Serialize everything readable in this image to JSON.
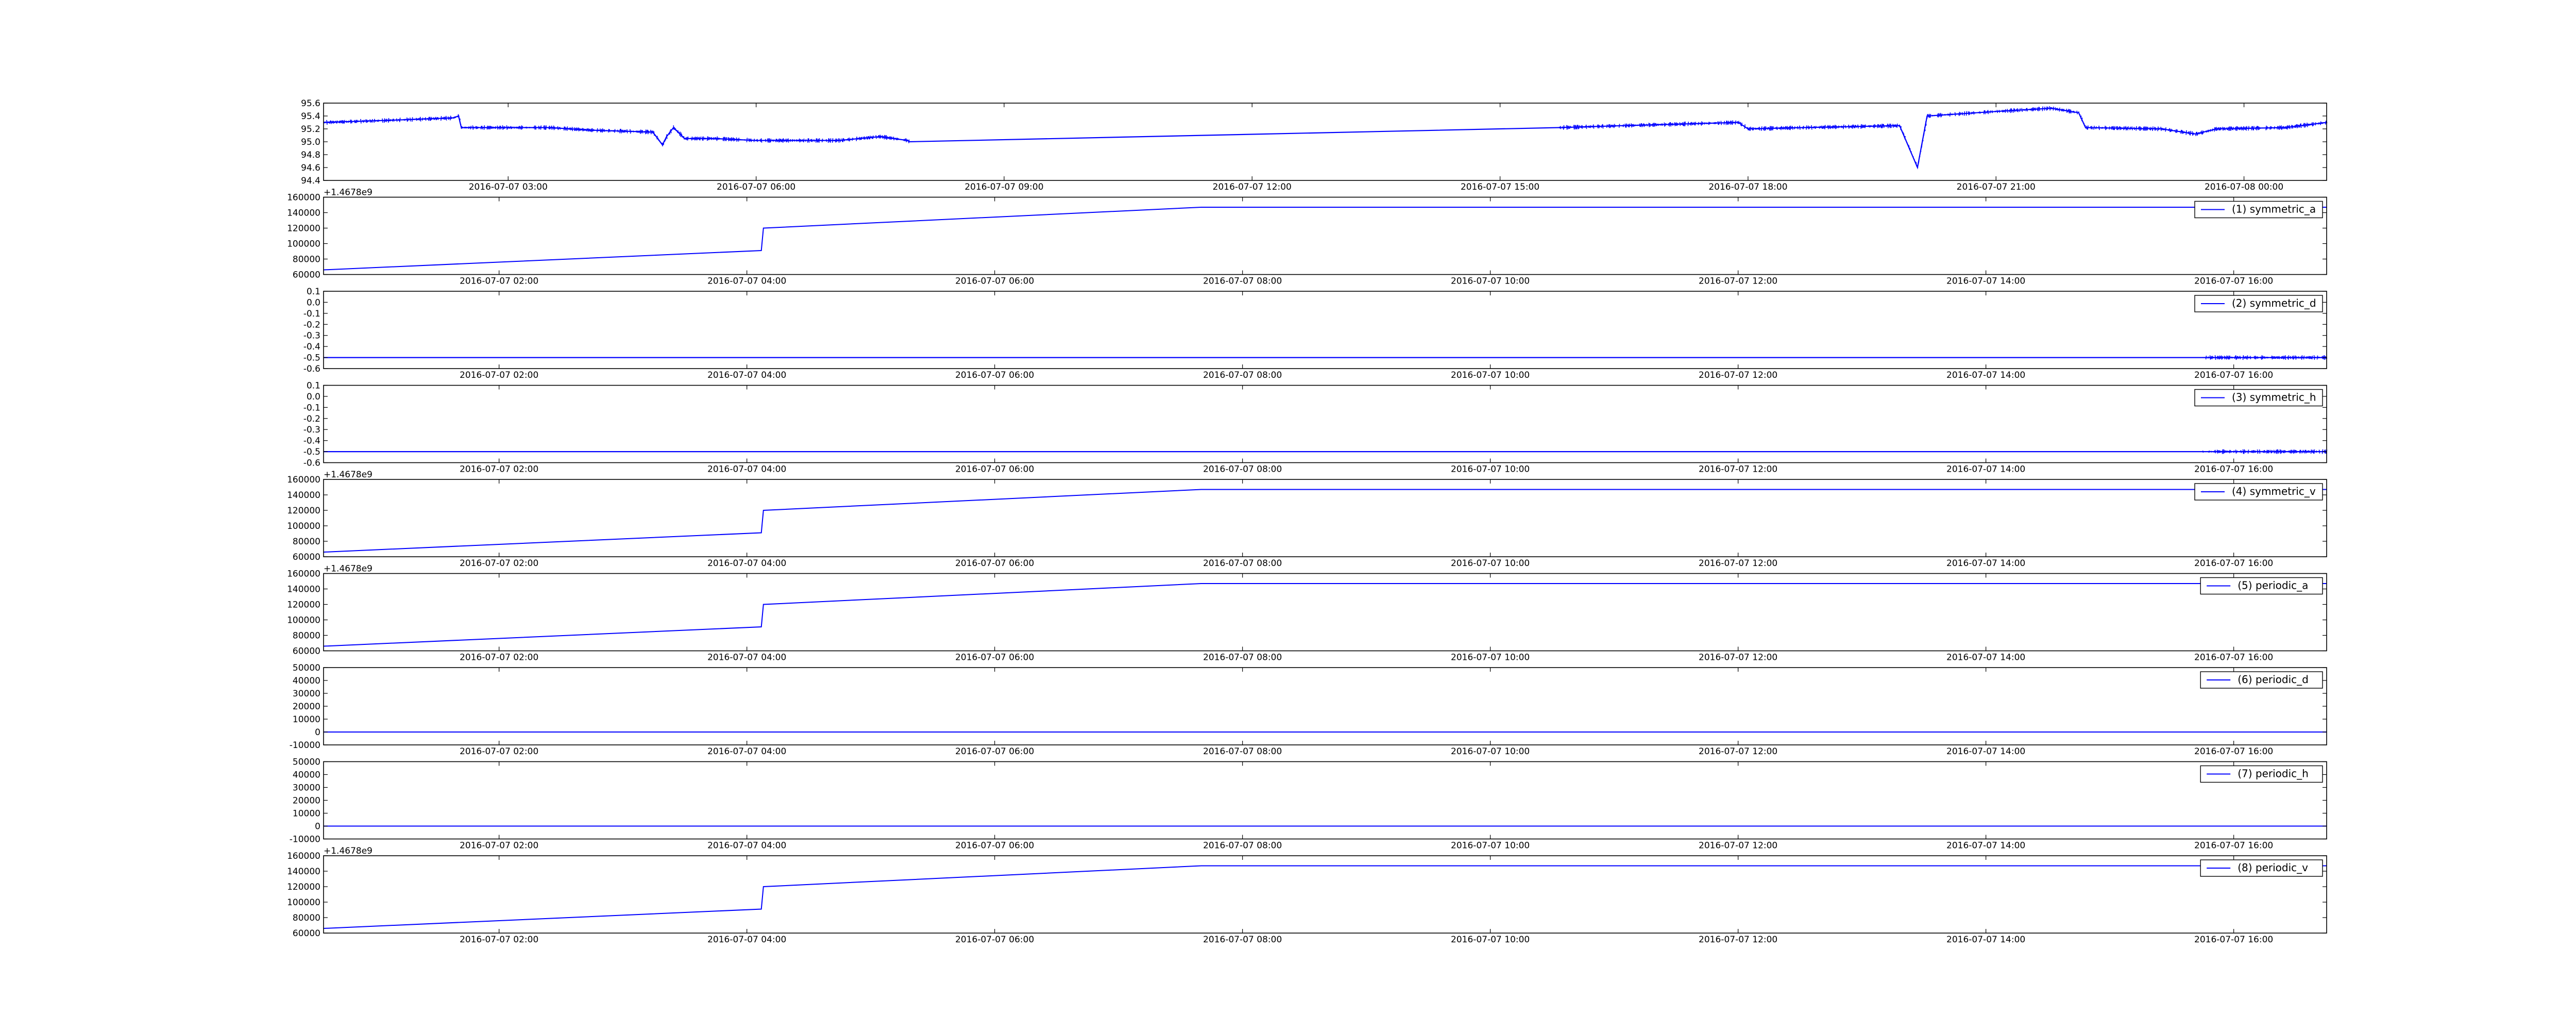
{
  "figure": {
    "background": "#ffffff"
  },
  "chart_data": [
    {
      "type": "line",
      "color": "#0000ff",
      "noisy": true,
      "ylim": [
        94.4,
        95.6
      ],
      "yticks": [
        "94.4",
        "94.6",
        "94.8",
        "95.0",
        "95.2",
        "95.4",
        "95.6"
      ],
      "offset_label": "",
      "x_range": [
        "2016-07-07 00:46",
        "2016-07-08 01:00"
      ],
      "xticks": [
        "2016-07-07 03:00",
        "2016-07-07 06:00",
        "2016-07-07 09:00",
        "2016-07-07 12:00",
        "2016-07-07 15:00",
        "2016-07-07 18:00",
        "2016-07-07 21:00",
        "2016-07-08 00:00"
      ],
      "legend": "",
      "points": [
        [
          "2016-07-07 00:46",
          95.3
        ],
        [
          "2016-07-07 01:30",
          95.33
        ],
        [
          "2016-07-07 02:20",
          95.37
        ],
        [
          "2016-07-07 02:24",
          95.4
        ],
        [
          "2016-07-07 02:26",
          95.22
        ],
        [
          "2016-07-07 03:30",
          95.22
        ],
        [
          "2016-07-07 04:00",
          95.18
        ],
        [
          "2016-07-07 04:45",
          95.15
        ],
        [
          "2016-07-07 04:52",
          94.95
        ],
        [
          "2016-07-07 04:55",
          95.08
        ],
        [
          "2016-07-07 05:00",
          95.22
        ],
        [
          "2016-07-07 05:08",
          95.05
        ],
        [
          "2016-07-07 05:30",
          95.05
        ],
        [
          "2016-07-07 06:00",
          95.02
        ],
        [
          "2016-07-07 07:00",
          95.02
        ],
        [
          "2016-07-07 07:30",
          95.08
        ],
        [
          "2016-07-07 07:50",
          95.02
        ],
        [
          "2016-07-07 07:51",
          95.0
        ],
        [
          "2016-07-07 15:43",
          95.22
        ],
        [
          "2016-07-07 16:30",
          95.25
        ],
        [
          "2016-07-07 17:53",
          95.3
        ],
        [
          "2016-07-07 18:00",
          95.2
        ],
        [
          "2016-07-07 18:40",
          95.22
        ],
        [
          "2016-07-07 19:50",
          95.25
        ],
        [
          "2016-07-07 20:03",
          94.6
        ],
        [
          "2016-07-07 20:10",
          95.4
        ],
        [
          "2016-07-07 21:00",
          95.47
        ],
        [
          "2016-07-07 21:40",
          95.52
        ],
        [
          "2016-07-07 22:00",
          95.45
        ],
        [
          "2016-07-07 22:05",
          95.22
        ],
        [
          "2016-07-07 23:00",
          95.2
        ],
        [
          "2016-07-07 23:25",
          95.12
        ],
        [
          "2016-07-07 23:40",
          95.2
        ],
        [
          "2016-07-08 00:30",
          95.22
        ],
        [
          "2016-07-08 01:00",
          95.3
        ]
      ]
    },
    {
      "type": "line",
      "color": "#0000ff",
      "noisy": false,
      "ylim": [
        60000,
        160000
      ],
      "yticks": [
        "60000",
        "80000",
        "100000",
        "120000",
        "140000",
        "160000"
      ],
      "offset_label": "+1.4678e9",
      "x_range": [
        "2016-07-07 00:35",
        "2016-07-07 16:45"
      ],
      "xticks": [
        "2016-07-07 02:00",
        "2016-07-07 04:00",
        "2016-07-07 06:00",
        "2016-07-07 08:00",
        "2016-07-07 10:00",
        "2016-07-07 12:00",
        "2016-07-07 14:00",
        "2016-07-07 16:00"
      ],
      "legend": "(1) symmetric_a",
      "points": [
        [
          "2016-07-07 00:35",
          66000
        ],
        [
          "2016-07-07 04:07",
          91000
        ],
        [
          "2016-07-07 04:08",
          120000
        ],
        [
          "2016-07-07 07:40",
          147000
        ],
        [
          "2016-07-07 16:45",
          147000
        ]
      ]
    },
    {
      "type": "line",
      "color": "#0000ff",
      "noisy": true,
      "ylim": [
        -0.6,
        0.1
      ],
      "yticks": [
        "-0.6",
        "-0.5",
        "-0.4",
        "-0.3",
        "-0.2",
        "-0.1",
        "0.0",
        "0.1"
      ],
      "offset_label": "",
      "x_range": [
        "2016-07-07 00:35",
        "2016-07-07 16:45"
      ],
      "xticks": [
        "2016-07-07 02:00",
        "2016-07-07 04:00",
        "2016-07-07 06:00",
        "2016-07-07 08:00",
        "2016-07-07 10:00",
        "2016-07-07 12:00",
        "2016-07-07 14:00",
        "2016-07-07 16:00"
      ],
      "legend": "(2) symmetric_d",
      "points": [
        [
          "2016-07-07 00:35",
          -0.5
        ],
        [
          "2016-07-07 07:40",
          -0.5
        ],
        [
          "2016-07-07 15:45",
          -0.5
        ],
        [
          "2016-07-07 16:45",
          -0.5
        ]
      ]
    },
    {
      "type": "line",
      "color": "#0000ff",
      "noisy": true,
      "ylim": [
        -0.6,
        0.1
      ],
      "yticks": [
        "-0.6",
        "-0.5",
        "-0.4",
        "-0.3",
        "-0.2",
        "-0.1",
        "0.0",
        "0.1"
      ],
      "offset_label": "",
      "x_range": [
        "2016-07-07 00:35",
        "2016-07-07 16:45"
      ],
      "xticks": [
        "2016-07-07 02:00",
        "2016-07-07 04:00",
        "2016-07-07 06:00",
        "2016-07-07 08:00",
        "2016-07-07 10:00",
        "2016-07-07 12:00",
        "2016-07-07 14:00",
        "2016-07-07 16:00"
      ],
      "legend": "(3) symmetric_h",
      "points": [
        [
          "2016-07-07 00:35",
          -0.5
        ],
        [
          "2016-07-07 07:40",
          -0.5
        ],
        [
          "2016-07-07 15:45",
          -0.5
        ],
        [
          "2016-07-07 16:45",
          -0.5
        ]
      ]
    },
    {
      "type": "line",
      "color": "#0000ff",
      "noisy": false,
      "ylim": [
        60000,
        160000
      ],
      "yticks": [
        "60000",
        "80000",
        "100000",
        "120000",
        "140000",
        "160000"
      ],
      "offset_label": "+1.4678e9",
      "x_range": [
        "2016-07-07 00:35",
        "2016-07-07 16:45"
      ],
      "xticks": [
        "2016-07-07 02:00",
        "2016-07-07 04:00",
        "2016-07-07 06:00",
        "2016-07-07 08:00",
        "2016-07-07 10:00",
        "2016-07-07 12:00",
        "2016-07-07 14:00",
        "2016-07-07 16:00"
      ],
      "legend": "(4) symmetric_v",
      "points": [
        [
          "2016-07-07 00:35",
          66000
        ],
        [
          "2016-07-07 04:07",
          91000
        ],
        [
          "2016-07-07 04:08",
          120000
        ],
        [
          "2016-07-07 07:40",
          147000
        ],
        [
          "2016-07-07 16:45",
          147000
        ]
      ]
    },
    {
      "type": "line",
      "color": "#0000ff",
      "noisy": false,
      "ylim": [
        60000,
        160000
      ],
      "yticks": [
        "60000",
        "80000",
        "100000",
        "120000",
        "140000",
        "160000"
      ],
      "offset_label": "+1.4678e9",
      "x_range": [
        "2016-07-07 00:35",
        "2016-07-07 16:45"
      ],
      "xticks": [
        "2016-07-07 02:00",
        "2016-07-07 04:00",
        "2016-07-07 06:00",
        "2016-07-07 08:00",
        "2016-07-07 10:00",
        "2016-07-07 12:00",
        "2016-07-07 14:00",
        "2016-07-07 16:00"
      ],
      "legend": "(5) periodic_a",
      "points": [
        [
          "2016-07-07 00:35",
          66000
        ],
        [
          "2016-07-07 04:07",
          91000
        ],
        [
          "2016-07-07 04:08",
          120000
        ],
        [
          "2016-07-07 07:40",
          147000
        ],
        [
          "2016-07-07 16:45",
          147000
        ]
      ]
    },
    {
      "type": "line",
      "color": "#0000ff",
      "noisy": false,
      "ylim": [
        -10000,
        50000
      ],
      "yticks": [
        "-10000",
        "0",
        "10000",
        "20000",
        "30000",
        "40000",
        "50000"
      ],
      "offset_label": "",
      "x_range": [
        "2016-07-07 00:35",
        "2016-07-07 16:45"
      ],
      "xticks": [
        "2016-07-07 02:00",
        "2016-07-07 04:00",
        "2016-07-07 06:00",
        "2016-07-07 08:00",
        "2016-07-07 10:00",
        "2016-07-07 12:00",
        "2016-07-07 14:00",
        "2016-07-07 16:00"
      ],
      "legend": "(6) periodic_d",
      "points": [
        [
          "2016-07-07 00:35",
          0
        ],
        [
          "2016-07-07 16:45",
          0
        ]
      ]
    },
    {
      "type": "line",
      "color": "#0000ff",
      "noisy": false,
      "ylim": [
        -10000,
        50000
      ],
      "yticks": [
        "-10000",
        "0",
        "10000",
        "20000",
        "30000",
        "40000",
        "50000"
      ],
      "offset_label": "",
      "x_range": [
        "2016-07-07 00:35",
        "2016-07-07 16:45"
      ],
      "xticks": [
        "2016-07-07 02:00",
        "2016-07-07 04:00",
        "2016-07-07 06:00",
        "2016-07-07 08:00",
        "2016-07-07 10:00",
        "2016-07-07 12:00",
        "2016-07-07 14:00",
        "2016-07-07 16:00"
      ],
      "legend": "(7) periodic_h",
      "points": [
        [
          "2016-07-07 00:35",
          0
        ],
        [
          "2016-07-07 16:45",
          0
        ]
      ]
    },
    {
      "type": "line",
      "color": "#0000ff",
      "noisy": false,
      "ylim": [
        60000,
        160000
      ],
      "yticks": [
        "60000",
        "80000",
        "100000",
        "120000",
        "140000",
        "160000"
      ],
      "offset_label": "+1.4678e9",
      "x_range": [
        "2016-07-07 00:35",
        "2016-07-07 16:45"
      ],
      "xticks": [
        "2016-07-07 02:00",
        "2016-07-07 04:00",
        "2016-07-07 06:00",
        "2016-07-07 08:00",
        "2016-07-07 10:00",
        "2016-07-07 12:00",
        "2016-07-07 14:00",
        "2016-07-07 16:00"
      ],
      "legend": "(8) periodic_v",
      "points": [
        [
          "2016-07-07 00:35",
          66000
        ],
        [
          "2016-07-07 04:07",
          91000
        ],
        [
          "2016-07-07 04:08",
          120000
        ],
        [
          "2016-07-07 07:40",
          147000
        ],
        [
          "2016-07-07 16:45",
          147000
        ]
      ]
    }
  ]
}
